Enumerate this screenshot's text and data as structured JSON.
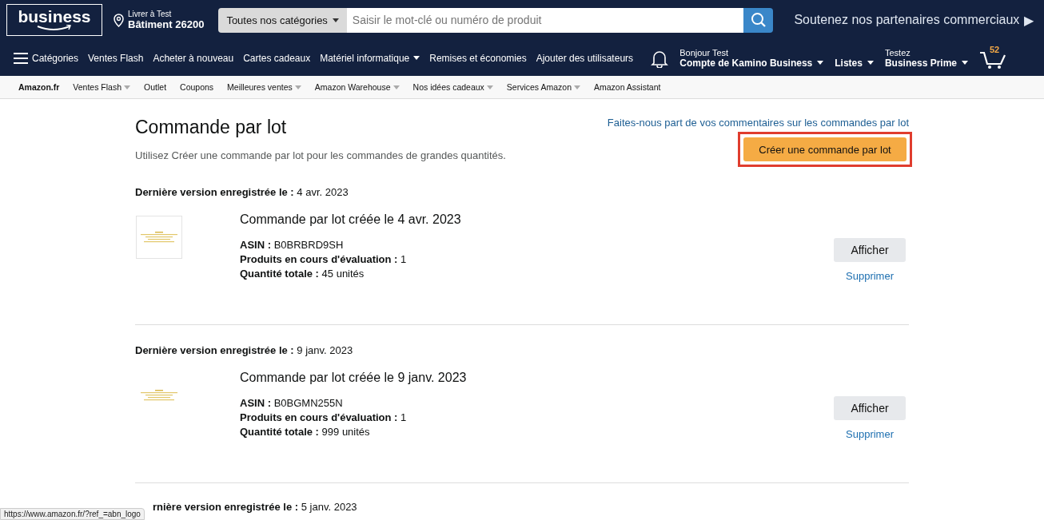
{
  "header": {
    "logo": "business",
    "deliver": {
      "line1": "Livrer à Test",
      "line2": "Bâtiment 26200"
    },
    "search": {
      "category": "Toutes nos catégories",
      "placeholder": "Saisir le mot-clé ou numéro de produit"
    },
    "promo": {
      "text": "Soutenez nos partenaires commerciaux",
      "arrow": "▶"
    }
  },
  "nav": {
    "items": [
      {
        "label": "Catégories",
        "kind": "menu",
        "dropdown": false
      },
      {
        "label": "Ventes Flash",
        "kind": "link",
        "dropdown": false
      },
      {
        "label": "Acheter à nouveau",
        "kind": "link",
        "dropdown": false
      },
      {
        "label": "Cartes cadeaux",
        "kind": "link",
        "dropdown": false
      },
      {
        "label": "Matériel informatique",
        "kind": "link",
        "dropdown": true
      },
      {
        "label": "Remises et économies",
        "kind": "link",
        "dropdown": false
      },
      {
        "label": "Ajouter des utilisateurs",
        "kind": "link",
        "dropdown": false
      }
    ],
    "account": {
      "greeting": "Bonjour Test",
      "name": "Compte de Kamino Business"
    },
    "lists": "Listes",
    "prime": {
      "line1": "Testez",
      "line2": "Business Prime"
    },
    "cart_count": "52"
  },
  "subnav": [
    {
      "label": "Amazon.fr",
      "bold": true,
      "dropdown": false
    },
    {
      "label": "Ventes Flash",
      "bold": false,
      "dropdown": true
    },
    {
      "label": "Outlet",
      "bold": false,
      "dropdown": false
    },
    {
      "label": "Coupons",
      "bold": false,
      "dropdown": false
    },
    {
      "label": "Meilleures ventes",
      "bold": false,
      "dropdown": true
    },
    {
      "label": "Amazon Warehouse",
      "bold": false,
      "dropdown": true
    },
    {
      "label": "Nos idées cadeaux",
      "bold": false,
      "dropdown": true
    },
    {
      "label": "Services Amazon",
      "bold": false,
      "dropdown": true
    },
    {
      "label": "Amazon Assistant",
      "bold": false,
      "dropdown": false
    }
  ],
  "page": {
    "title": "Commande par lot",
    "subtitle": "Utilisez Créer une commande par lot pour les commandes de grandes quantités.",
    "feedback_link": "Faites-nous part de vos commentaires sur les commandes par lot",
    "create_button": "Créer une commande par lot"
  },
  "orders": [
    {
      "saved_label": "Dernière version enregistrée le :",
      "saved_date": "4 avr. 2023",
      "thumbnail": {
        "kind": "picture",
        "framed": true
      },
      "title": "Commande par lot créée le 4 avr. 2023",
      "details": [
        {
          "label": "ASIN :",
          "value": "B0BRBRD9SH"
        },
        {
          "label": "Produits en cours d'évaluation :",
          "value": "1"
        },
        {
          "label": "Quantité totale :",
          "value": "45 unités"
        }
      ],
      "view_button": "Afficher",
      "delete_link": "Supprimer"
    },
    {
      "saved_label": "Dernière version enregistrée le :",
      "saved_date": "9 janv. 2023",
      "thumbnail": {
        "kind": "picture",
        "framed": false
      },
      "title": "Commande par lot créée le 9 janv. 2023",
      "details": [
        {
          "label": "ASIN :",
          "value": "B0BGMN255N"
        },
        {
          "label": "Produits en cours d'évaluation :",
          "value": "1"
        },
        {
          "label": "Quantité totale :",
          "value": "999 unités"
        }
      ],
      "view_button": "Afficher",
      "delete_link": "Supprimer"
    },
    {
      "saved_label": "rnière version enregistrée le :",
      "saved_date": "5 janv. 2023"
    }
  ],
  "status_url": "https://www.amazon.fr/?ref_=abn_logo"
}
